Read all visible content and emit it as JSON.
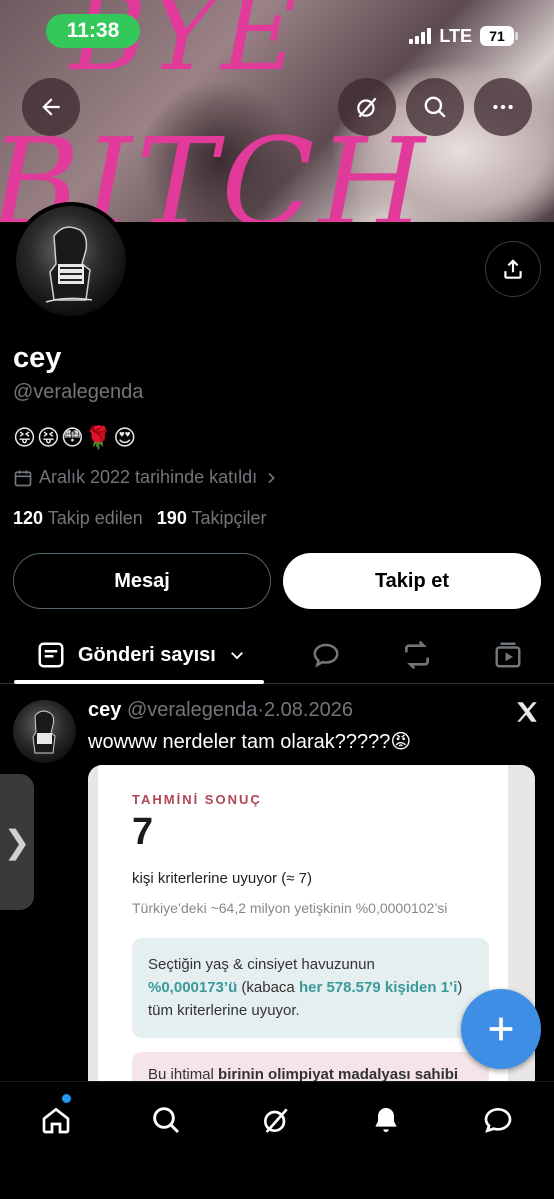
{
  "status_bar": {
    "time": "11:38",
    "network": "LTE",
    "battery": "71"
  },
  "banner": {
    "line1": "BYE",
    "line2": "BITCH"
  },
  "header_icons": [
    "back-arrow-icon",
    "grok-icon",
    "search-icon",
    "more-icon"
  ],
  "profile": {
    "name": "cey",
    "handle": "@veralegenda",
    "bio": "😝😝😳🌹😍",
    "joined": "Aralık 2022 tarihinde katıldı",
    "following_count": "120",
    "following_label": "Takip edilen",
    "followers_count": "190",
    "followers_label": "Takipçiler"
  },
  "actions": {
    "message": "Mesaj",
    "follow": "Takip et"
  },
  "tabs": {
    "active_label": "Gönderi sayısı"
  },
  "post": {
    "name": "cey",
    "handle": "@veralegenda",
    "separator": "·",
    "date": "2.08.2026",
    "text": "wowww nerdeler tam olarak?????😡",
    "card": {
      "label": "TAHMİNİ SONUÇ",
      "number": "7",
      "line1": "kişi kriterlerine uyuyor (≈ 7)",
      "line2": "Türkiye’deki ~64,2 milyon yetişkinin %0,0000102’si",
      "box_prefix": "Seçtiğin yaş & cinsiyet havuzunun",
      "box_pct": "%0,000173’ü",
      "box_mid": "(kabaca",
      "box_ratio": "her 578.579 kişiden 1’i",
      "box_suffix": ")",
      "box_end": "tüm kriterlerine uyuyor.",
      "box2_prefix": "Bu ihtimal",
      "box2_bold": "birinin olimpiyat madalyası sahibi"
    }
  },
  "side_handle": "❯",
  "colors": {
    "accent": "#1d9bf0",
    "fab": "#3e8ee6",
    "status_green": "#34c759",
    "banner_text": "#e23a9a"
  }
}
